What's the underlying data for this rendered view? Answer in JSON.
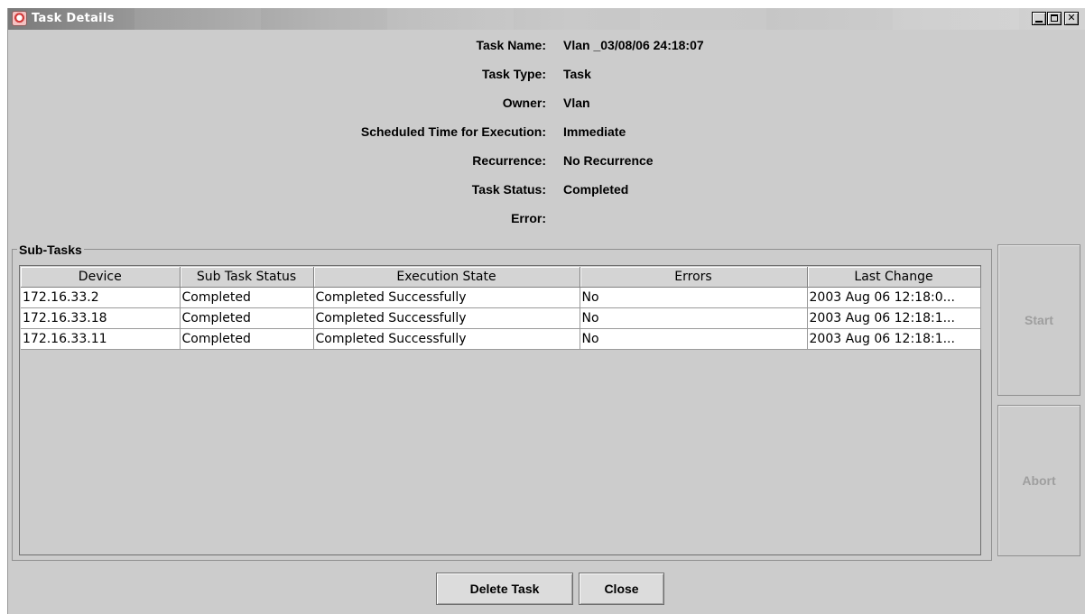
{
  "window": {
    "title": "Task Details",
    "icon": "java-app-icon",
    "controls": [
      "minimize-icon",
      "maximize-icon",
      "close-icon"
    ]
  },
  "details": [
    {
      "label": "Task Name:",
      "value": "Vlan _03/08/06 24:18:07"
    },
    {
      "label": "Task Type:",
      "value": "Task"
    },
    {
      "label": "Owner:",
      "value": "Vlan"
    },
    {
      "label": "Scheduled Time for Execution:",
      "value": "Immediate"
    },
    {
      "label": "Recurrence:",
      "value": "No Recurrence"
    },
    {
      "label": "Task Status:",
      "value": "Completed"
    },
    {
      "label": "Error:",
      "value": ""
    }
  ],
  "subtasks": {
    "title": "Sub-Tasks",
    "columns": [
      "Device",
      "Sub Task Status",
      "Execution State",
      "Errors",
      "Last Change"
    ],
    "rows": [
      [
        "172.16.33.2",
        "Completed",
        "Completed Successfully",
        "No",
        "2003 Aug 06  12:18:0..."
      ],
      [
        "172.16.33.18",
        "Completed",
        "Completed Successfully",
        "No",
        "2003 Aug 06  12:18:1..."
      ],
      [
        "172.16.33.11",
        "Completed",
        "Completed Successfully",
        "No",
        "2003 Aug 06  12:18:1..."
      ]
    ]
  },
  "side_buttons": {
    "start": "Start",
    "abort": "Abort",
    "disabled_color": "#9e9e9e"
  },
  "buttons": {
    "delete": "Delete Task",
    "close": "Close"
  }
}
